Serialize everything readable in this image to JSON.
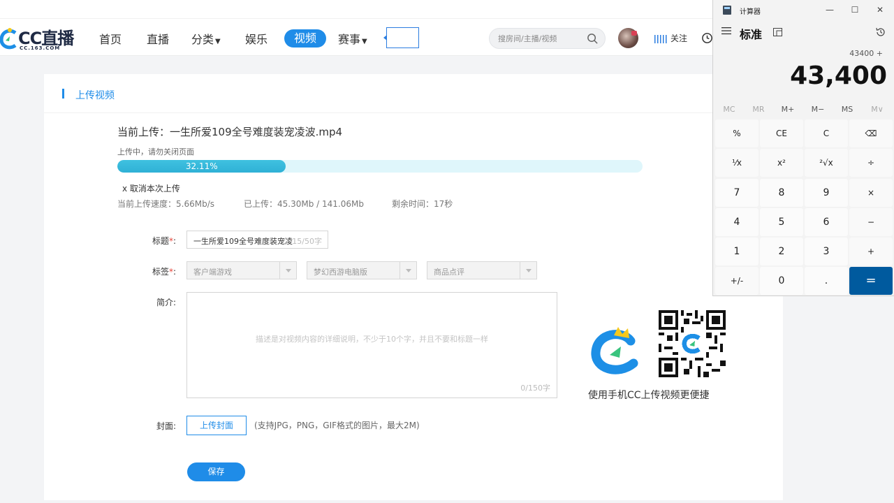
{
  "nav": {
    "logo_text": "CC直播",
    "logo_sub": "CC.163.COM",
    "items": {
      "home": "首页",
      "live": "直播",
      "category": "分类",
      "entertainment": "娱乐",
      "video": "视频",
      "events": "赛事"
    },
    "search_placeholder": "搜房间/主播/视频",
    "follow": "关注",
    "accent_color": "#1f8ce8"
  },
  "page": {
    "section_title": "上传视频",
    "current_upload_label": "当前上传：",
    "current_file": "一生所爱109全号难度装宠凌波.mp4",
    "uploading_hint": "上传中，请勿关闭页面",
    "progress_percent": 32.11,
    "progress_label": "32.11%",
    "cancel": "x 取消本次上传",
    "speed": "当前上传速度：5.66Mb/s",
    "uploaded": "已上传：45.30Mb / 141.06Mb",
    "remaining": "剩余时间：17秒"
  },
  "form": {
    "title_label": "标题",
    "title_value": "一生所爱109全号难度装宠凌",
    "title_count": "15/50字",
    "tags_label": "标签",
    "tags": [
      "客户端游戏",
      "梦幻西游电脑版",
      "商品点评"
    ],
    "desc_label": "简介:",
    "desc_placeholder": "描述是对视频内容的详细说明，不少于10个字，并且不要和标题一样",
    "desc_count": "0/150字",
    "cover_label": "封面:",
    "cover_button": "上传封面",
    "cover_hint": "(支持JPG，PNG，GIF格式的图片，最大2M)",
    "save_button": "保存",
    "required_mark": "*",
    "colon": ":"
  },
  "promo": {
    "caption": "使用手机CC上传视频更便捷"
  },
  "calculator": {
    "title": "计算器",
    "mode": "标准",
    "expression": "43400 +",
    "display": "43,400",
    "memory": [
      "MC",
      "MR",
      "M+",
      "M−",
      "MS",
      "M∨"
    ],
    "keys": [
      [
        "%",
        "CE",
        "C",
        "⌫"
      ],
      [
        "⅟x",
        "x²",
        "²√x",
        "÷"
      ],
      [
        "7",
        "8",
        "9",
        "×"
      ],
      [
        "4",
        "5",
        "6",
        "−"
      ],
      [
        "1",
        "2",
        "3",
        "+"
      ],
      [
        "+/-",
        "0",
        ".",
        "="
      ]
    ],
    "equals_color": "#005a9e"
  }
}
